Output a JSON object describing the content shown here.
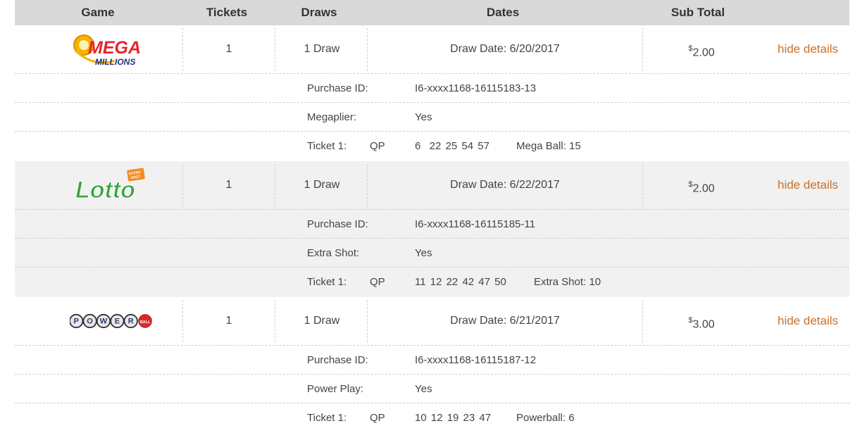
{
  "header": {
    "game": "Game",
    "tickets": "Tickets",
    "draws": "Draws",
    "dates": "Dates",
    "subtotal": "Sub Total"
  },
  "colors": {
    "header_bg": "#d9d9d9",
    "link": "#c8702a",
    "shaded_row": "#f1f1f1"
  },
  "games": [
    {
      "logo_name": "mega-millions-logo",
      "logo_text_1": "MEGA",
      "logo_text_2": "MILLIONS",
      "tickets": "1",
      "draws": "1 Draw",
      "draw_date": "Draw Date: 6/20/2017",
      "currency": "$",
      "subtotal": "2.00",
      "toggle": "hide details",
      "purchase_label": "Purchase ID:",
      "purchase_id": "I6-xxxx1168-16115183-13",
      "option_label": "Megaplier:",
      "option_value": "Yes",
      "ticket_label": "Ticket 1:",
      "ticket_type": "QP",
      "numbers": "6  22 25 54 57",
      "bonus": "Mega Ball: 15"
    },
    {
      "logo_name": "lotto-logo",
      "logo_text_1": "Lotto",
      "logo_text_2": "EXTRA SHOT",
      "tickets": "1",
      "draws": "1 Draw",
      "draw_date": "Draw Date: 6/22/2017",
      "currency": "$",
      "subtotal": "2.00",
      "toggle": "hide details",
      "purchase_label": "Purchase ID:",
      "purchase_id": "I6-xxxx1168-16115185-11",
      "option_label": "Extra Shot:",
      "option_value": "Yes",
      "ticket_label": "Ticket 1:",
      "ticket_type": "QP",
      "numbers": "11 12 22 42 47 50",
      "bonus": "Extra Shot: 10"
    },
    {
      "logo_name": "powerball-logo",
      "logo_letters": [
        "P",
        "O",
        "W",
        "E",
        "R"
      ],
      "logo_ball": "BALL",
      "tickets": "1",
      "draws": "1 Draw",
      "draw_date": "Draw Date: 6/21/2017",
      "currency": "$",
      "subtotal": "3.00",
      "toggle": "hide details",
      "purchase_label": "Purchase ID:",
      "purchase_id": "I6-xxxx1168-16115187-12",
      "option_label": "Power Play:",
      "option_value": "Yes",
      "ticket_label": "Ticket 1:",
      "ticket_type": "QP",
      "numbers": "10 12 19 23 47",
      "bonus": "Powerball: 6"
    }
  ]
}
